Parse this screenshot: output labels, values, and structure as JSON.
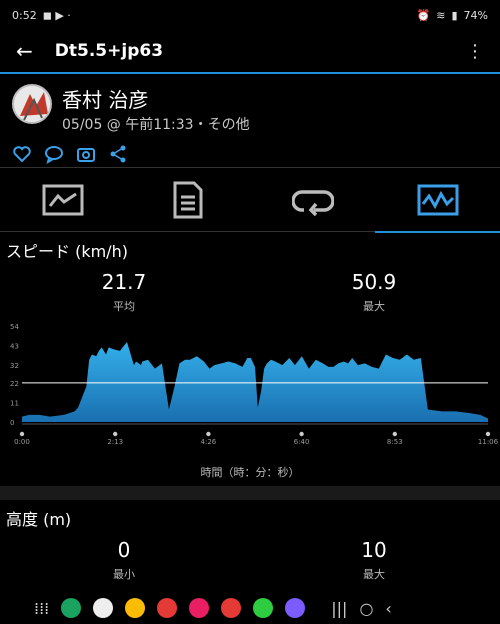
{
  "status": {
    "time": "0:52",
    "battery": "74%"
  },
  "appbar": {
    "title": "Dt5.5+jp63"
  },
  "profile": {
    "name": "香村 治彦",
    "datetime": "05/05 @ 午前11:33・その他"
  },
  "speed": {
    "title": "スピード (km/h)",
    "avg_value": "21.7",
    "avg_label": "平均",
    "max_value": "50.9",
    "max_label": "最大"
  },
  "chart_data": {
    "type": "area",
    "title": "",
    "xlabel": "時間（時：分：秒）",
    "ylabel": "",
    "ylim": [
      0,
      54
    ],
    "yticks": [
      0,
      11,
      22,
      32,
      43,
      54
    ],
    "xtick_labels": [
      "0:00",
      "2:13",
      "4:26",
      "6:40",
      "8:53",
      "11:06"
    ],
    "x_range_minutes": [
      0,
      666
    ],
    "reference_line": {
      "y": 22
    },
    "fill_color": "#2a9fd6",
    "series": [
      {
        "values_x_min": [
          0,
          10,
          25,
          40,
          60,
          75,
          80,
          92,
          96,
          100,
          106,
          110,
          114,
          120,
          124,
          130,
          140,
          150,
          160,
          163,
          167,
          170,
          172,
          180,
          190,
          200,
          210,
          218,
          225,
          233,
          240,
          250,
          260,
          268,
          275,
          285,
          295,
          305,
          315,
          322,
          327,
          333,
          337,
          342,
          346,
          350,
          356,
          362,
          372,
          382,
          390,
          400,
          410,
          420,
          430,
          438,
          445,
          452,
          460,
          466,
          472,
          480,
          490,
          500,
          510,
          520,
          530,
          540,
          550,
          560,
          570,
          580,
          600,
          620,
          640,
          655,
          666
        ],
        "values_y": [
          3,
          4,
          4,
          3,
          4,
          6,
          8,
          20,
          35,
          38,
          37,
          40,
          42,
          38,
          42,
          41,
          40,
          45,
          32,
          34,
          33,
          32,
          34,
          35,
          30,
          33,
          7,
          20,
          33,
          35,
          35,
          37,
          34,
          30,
          32,
          33,
          34,
          33,
          31,
          36,
          36,
          31,
          8,
          18,
          30,
          33,
          35,
          34,
          32,
          36,
          32,
          37,
          30,
          35,
          33,
          31,
          31,
          33,
          34,
          33,
          36,
          32,
          33,
          31,
          30,
          38,
          36,
          35,
          38,
          35,
          36,
          7,
          6,
          6,
          5,
          4,
          2
        ]
      }
    ]
  },
  "elevation": {
    "title": "高度 (m)",
    "min_value": "0",
    "min_label": "最小",
    "max_value": "10",
    "max_label": "最大"
  }
}
